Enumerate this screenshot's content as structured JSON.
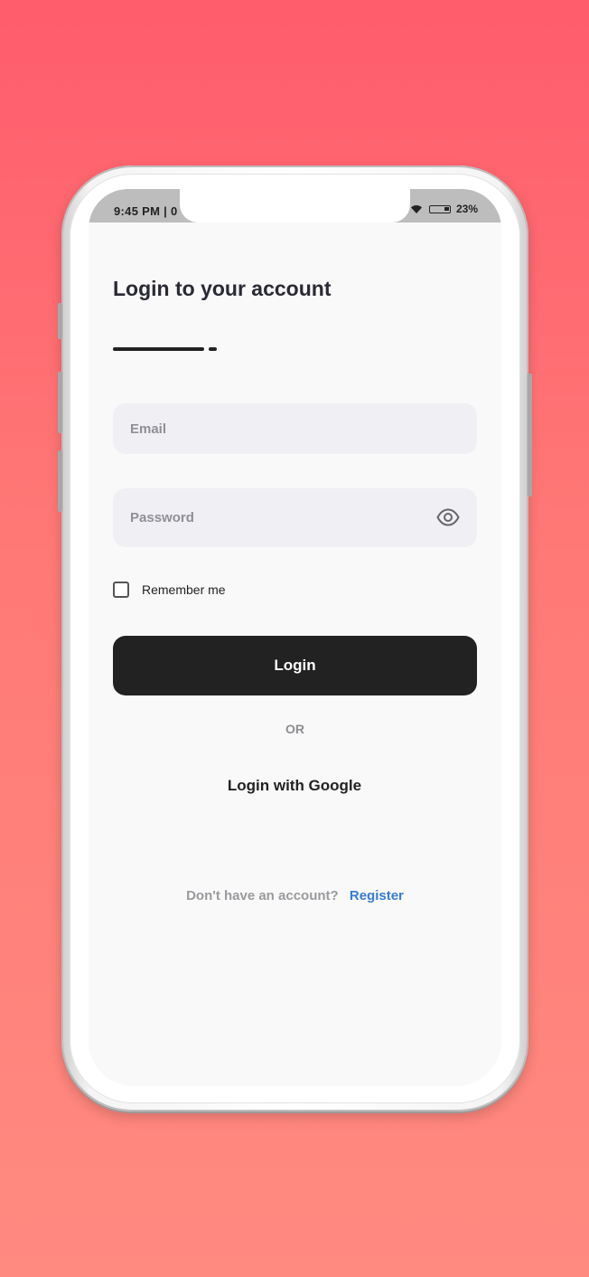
{
  "status_bar": {
    "time": "9:45 PM | 0",
    "battery": "23%"
  },
  "login": {
    "title": "Login to your account",
    "email_placeholder": "Email",
    "password_placeholder": "Password",
    "remember_label": "Remember me",
    "remember_checked": false,
    "button_label": "Login",
    "or_text": "OR",
    "google_label": "Login with Google",
    "register_prompt": "Don't have an account?",
    "register_link": "Register"
  },
  "colors": {
    "background_top": "#ff5c6c",
    "background_bottom": "#ff8a80",
    "button": "#222222",
    "link": "#3a7bd5",
    "field": "#efeff4"
  },
  "icons": [
    "wifi-icon",
    "battery-icon",
    "eye-icon",
    "checkbox-icon"
  ]
}
